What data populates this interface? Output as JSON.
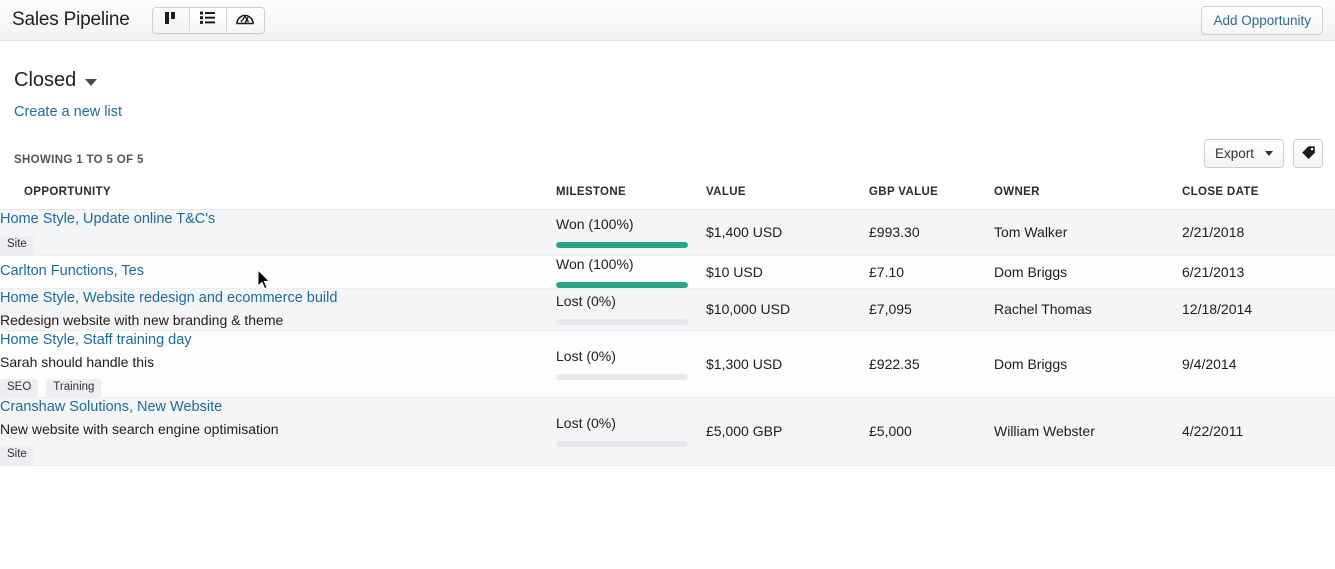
{
  "topbar": {
    "app_title": "Sales Pipeline",
    "views": [
      {
        "name": "board-view",
        "icon": "board-icon",
        "active": true
      },
      {
        "name": "list-view",
        "icon": "list-icon",
        "active": false
      },
      {
        "name": "dashboard-view",
        "icon": "gauge-icon",
        "active": false
      }
    ],
    "add_opportunity_label": "Add Opportunity"
  },
  "list_header": {
    "title": "Closed",
    "create_list_label": "Create a new list"
  },
  "toolbar": {
    "showing_text": "SHOWING 1 TO 5 OF 5",
    "export_label": "Export",
    "tag_button_icon": "tag-icon"
  },
  "table": {
    "columns": [
      "OPPORTUNITY",
      "MILESTONE",
      "VALUE",
      "GBP VALUE",
      "OWNER",
      "CLOSE DATE"
    ],
    "rows": [
      {
        "company": "Home Style,",
        "opportunity": "Update online T&C's",
        "description": "",
        "tags": [
          "Site"
        ],
        "milestone_label": "Won (100%)",
        "milestone_percent": 100,
        "value": "$1,400 USD",
        "gbp_value": "£993.30",
        "owner": "Tom Walker",
        "close_date": "2/21/2018"
      },
      {
        "company": "Carlton Functions,",
        "opportunity": "Tes",
        "description": "",
        "tags": [],
        "milestone_label": "Won (100%)",
        "milestone_percent": 100,
        "value": "$10 USD",
        "gbp_value": "£7.10",
        "owner": "Dom Briggs",
        "close_date": "6/21/2013"
      },
      {
        "company": "Home Style,",
        "opportunity": "Website redesign and ecommerce build",
        "description": "Redesign website with new branding & theme",
        "tags": [],
        "milestone_label": "Lost (0%)",
        "milestone_percent": 0,
        "value": "$10,000 USD",
        "gbp_value": "£7,095",
        "owner": "Rachel Thomas",
        "close_date": "12/18/2014"
      },
      {
        "company": "Home Style,",
        "opportunity": "Staff training day",
        "description": "Sarah should handle this",
        "tags": [
          "SEO",
          "Training"
        ],
        "milestone_label": "Lost (0%)",
        "milestone_percent": 0,
        "value": "$1,300 USD",
        "gbp_value": "£922.35",
        "owner": "Dom Briggs",
        "close_date": "9/4/2014"
      },
      {
        "company": "Cranshaw Solutions,",
        "opportunity": "New Website",
        "description": "New website with search engine optimisation",
        "tags": [
          "Site"
        ],
        "milestone_label": "Lost (0%)",
        "milestone_percent": 0,
        "value": "£5,000 GBP",
        "gbp_value": "£5,000",
        "owner": "William Webster",
        "close_date": "4/22/2011"
      }
    ]
  },
  "colors": {
    "link": "#1f6b9a",
    "milestone_won": "#2aa587",
    "milestone_track": "#e6e8ec",
    "row_stripe": "#f4f5f7"
  }
}
